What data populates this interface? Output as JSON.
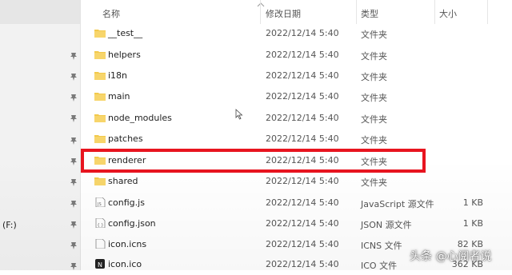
{
  "header": {
    "name": "名称",
    "modified": "修改日期",
    "type": "类型",
    "size": "大小"
  },
  "sidebar": {
    "drive_label": "(F:)"
  },
  "files": [
    {
      "name": "__test__",
      "date": "2022/12/14 5:40",
      "type": "文件夹",
      "size": "",
      "icon": "folder-icon"
    },
    {
      "name": "helpers",
      "date": "2022/12/14 5:40",
      "type": "文件夹",
      "size": "",
      "icon": "folder-icon"
    },
    {
      "name": "i18n",
      "date": "2022/12/14 5:40",
      "type": "文件夹",
      "size": "",
      "icon": "folder-icon"
    },
    {
      "name": "main",
      "date": "2022/12/14 5:40",
      "type": "文件夹",
      "size": "",
      "icon": "folder-icon"
    },
    {
      "name": "node_modules",
      "date": "2022/12/14 5:40",
      "type": "文件夹",
      "size": "",
      "icon": "folder-icon"
    },
    {
      "name": "patches",
      "date": "2022/12/14 5:40",
      "type": "文件夹",
      "size": "",
      "icon": "folder-icon"
    },
    {
      "name": "renderer",
      "date": "2022/12/14 5:40",
      "type": "文件夹",
      "size": "",
      "icon": "folder-icon"
    },
    {
      "name": "shared",
      "date": "2022/12/14 5:40",
      "type": "文件夹",
      "size": "",
      "icon": "folder-icon"
    },
    {
      "name": "config.js",
      "date": "2022/12/14 5:40",
      "type": "JavaScript 源文件",
      "size": "1 KB",
      "icon": "js-file-icon"
    },
    {
      "name": "config.json",
      "date": "2022/12/14 5:40",
      "type": "JSON 源文件",
      "size": "1 KB",
      "icon": "json-file-icon"
    },
    {
      "name": "icon.icns",
      "date": "2022/12/14 5:40",
      "type": "ICNS 文件",
      "size": "82 KB",
      "icon": "file-icon"
    },
    {
      "name": "icon.ico",
      "date": "2022/12/14 5:40",
      "type": "ICO 文件",
      "size": "362 KB",
      "icon": "ico-file-icon"
    }
  ],
  "watermark": "头条 @心阅者说",
  "colors": {
    "folder": "#f2c94c",
    "highlight": "#e8141f"
  }
}
